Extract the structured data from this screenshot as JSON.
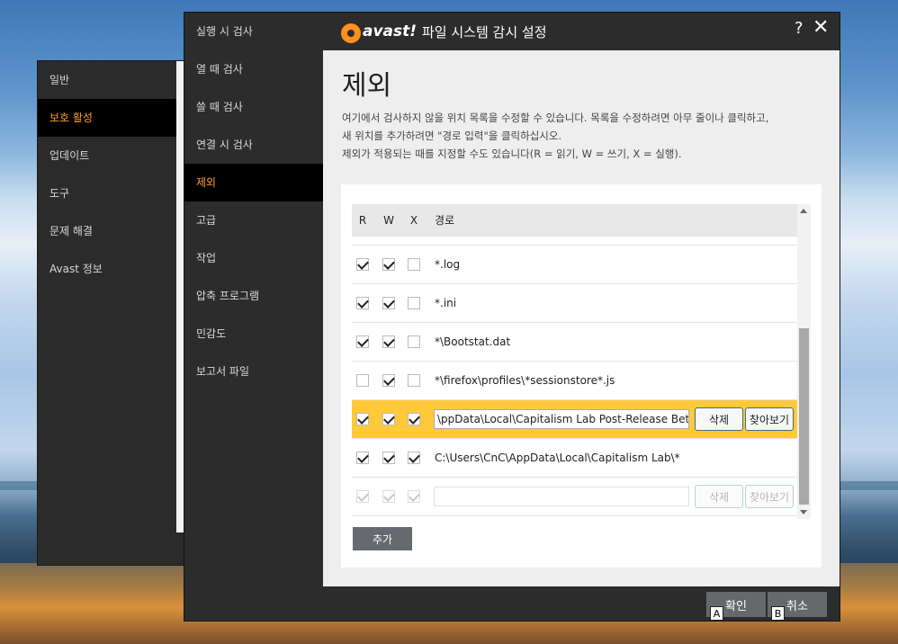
{
  "back_window": {
    "nav": [
      {
        "label": "일반",
        "active": false
      },
      {
        "label": "보호 활성",
        "active": true
      },
      {
        "label": "업데이트",
        "active": false
      },
      {
        "label": "도구",
        "active": false
      },
      {
        "label": "문제 해결",
        "active": false
      },
      {
        "label": "Avast 정보",
        "active": false
      }
    ]
  },
  "window": {
    "logo_text": "avast!",
    "title": "파일 시스템 감시 설정",
    "help": "?",
    "close": "✕"
  },
  "left_nav": [
    {
      "label": "실행 시 검사",
      "active": false
    },
    {
      "label": "열 때 검사",
      "active": false
    },
    {
      "label": "쓸 때 검사",
      "active": false
    },
    {
      "label": "연결 시 검사",
      "active": false
    },
    {
      "label": "제외",
      "active": true
    },
    {
      "label": "고급",
      "active": false
    },
    {
      "label": "작업",
      "active": false
    },
    {
      "label": "압축 프로그램",
      "active": false
    },
    {
      "label": "민감도",
      "active": false
    },
    {
      "label": "보고서 파일",
      "active": false
    }
  ],
  "main": {
    "heading": "제외",
    "description": [
      "여기에서 검사하지 않을 위치 목록을 수정할 수 있습니다. 목록을 수정하려면 아무 줄이나 클릭하고,",
      "새 위치를 추가하려면 \"경로 입력\"을 클릭하십시오.",
      "제외가 적용되는 때를 지정할 수도 있습니다(R = 읽기, W = 쓰기, X = 실행)."
    ],
    "columns": {
      "r": "R",
      "w": "W",
      "x": "X",
      "path": "경로"
    },
    "rows": [
      {
        "r": true,
        "w": true,
        "x": false,
        "path": "*.log",
        "selected": false,
        "editing": false
      },
      {
        "r": true,
        "w": true,
        "x": false,
        "path": "*.ini",
        "selected": false,
        "editing": false
      },
      {
        "r": true,
        "w": true,
        "x": false,
        "path": "*\\Bootstat.dat",
        "selected": false,
        "editing": false
      },
      {
        "r": false,
        "w": true,
        "x": false,
        "path": "*\\firefox\\profiles\\*sessionstore*.js",
        "selected": false,
        "editing": false
      },
      {
        "r": true,
        "w": true,
        "x": true,
        "path": "\\ppData\\Local\\Capitalism Lab Post-Release Beta\\*",
        "selected": true,
        "editing": true
      },
      {
        "r": true,
        "w": true,
        "x": true,
        "path": "C:\\Users\\CnC\\AppData\\Local\\Capitalism Lab\\*",
        "selected": false,
        "editing": false
      },
      {
        "r": true,
        "w": true,
        "x": true,
        "path": "",
        "selected": false,
        "editing": true,
        "disabled": true
      }
    ],
    "delete_label": "삭제",
    "browse_label": "찾아보기",
    "add_label": "추가"
  },
  "footer": {
    "ok_label": "확인",
    "cancel_label": "취소",
    "ok_key": "A",
    "cancel_key": "B"
  },
  "colors": {
    "accent": "#ff9c2a",
    "selected_row": "#ffc93a",
    "window_bg": "#2c2c2c"
  }
}
